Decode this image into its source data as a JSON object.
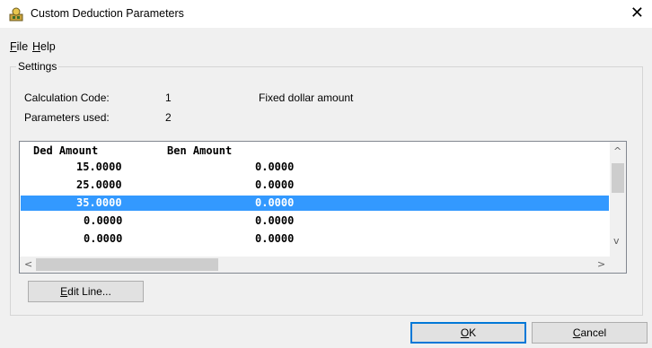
{
  "window": {
    "title": "Custom Deduction Parameters",
    "close_glyph": "✕"
  },
  "menu": {
    "file_hotkey": "F",
    "file_rest": "ile",
    "help_hotkey": "H",
    "help_rest": "elp"
  },
  "settings": {
    "legend": "Settings",
    "calc_code_label": "Calculation Code:",
    "calc_code_value": "1",
    "calc_code_desc": "Fixed dollar amount",
    "params_used_label": "Parameters used:",
    "params_used_value": "2"
  },
  "list": {
    "columns": [
      "Ded Amount",
      "Ben Amount"
    ],
    "rows": [
      {
        "ded": "15.0000",
        "ben": "0.0000"
      },
      {
        "ded": "25.0000",
        "ben": "0.0000"
      },
      {
        "ded": "35.0000",
        "ben": "0.0000"
      },
      {
        "ded": "0.0000",
        "ben": "0.0000"
      },
      {
        "ded": "0.0000",
        "ben": "0.0000"
      }
    ],
    "selected_index": 2
  },
  "buttons": {
    "edit_line_hotkey": "E",
    "edit_line_rest": "dit Line...",
    "ok_hotkey": "O",
    "ok_rest": "K",
    "cancel_hotkey": "C",
    "cancel_rest": "ancel"
  },
  "icons": {
    "app": "payroll-app-icon",
    "close": "close-icon",
    "scroll_up": "chevron-up-icon",
    "scroll_down": "chevron-down-icon",
    "scroll_left": "chevron-left-icon",
    "scroll_right": "chevron-right-icon"
  },
  "colors": {
    "selection": "#3399ff",
    "default_button_border": "#0078d7"
  }
}
